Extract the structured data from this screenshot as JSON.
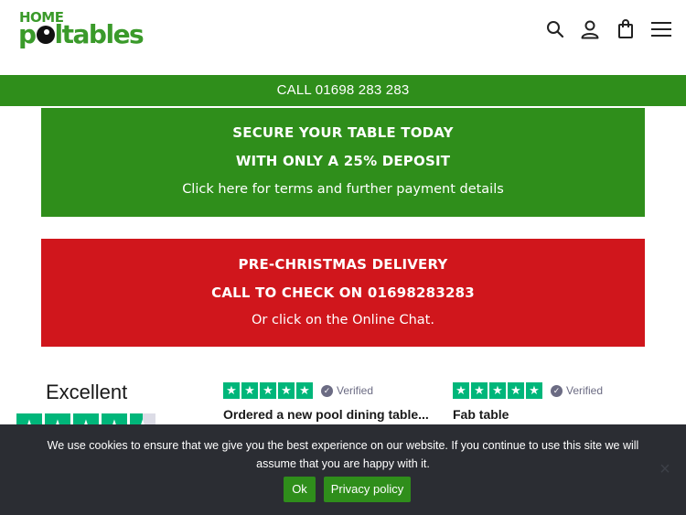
{
  "header": {
    "logo_top": "HOME",
    "logo_left": "p",
    "logo_right": "ltables",
    "icons": [
      "search-icon",
      "user-icon",
      "shopping-bag-icon",
      "menu-icon"
    ]
  },
  "callbar": {
    "text": "CALL 01698 283 283"
  },
  "promo_green": {
    "line1": "SECURE YOUR TABLE TODAY",
    "line2": "WITH ONLY A 25% DEPOSIT",
    "line3": "Click here for terms and further payment details"
  },
  "promo_red": {
    "line1": "PRE-CHRISTMAS DELIVERY",
    "line2": "CALL TO CHECK ON 01698283283",
    "line3": "Or click on the Online Chat."
  },
  "trustpilot": {
    "rating_label": "Excellent",
    "rating_stars": 4.5,
    "reviews": [
      {
        "stars": 5,
        "verified_label": "Verified",
        "title": "Ordered a new pool dining table..."
      },
      {
        "stars": 5,
        "verified_label": "Verified",
        "title": "Fab table"
      }
    ]
  },
  "cookie": {
    "message": "We use cookies to ensure that we give you the best experience on our website. If you continue to use this site we will assume that you are happy with it.",
    "ok_label": "Ok",
    "policy_label": "Privacy policy",
    "close_symbol": "×"
  },
  "colors": {
    "brand_green": "#2f8e1b",
    "alert_red": "#d0161c",
    "trustpilot_green": "#00b67a",
    "cookie_bg": "#2b2d33"
  }
}
